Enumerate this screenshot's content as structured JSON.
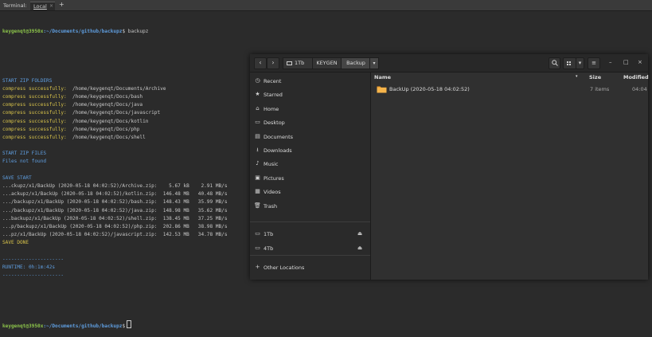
{
  "terminal": {
    "title": "Terminal:",
    "tab_label": "Local",
    "tab_close": "×",
    "add_tab": "+",
    "prompt_user": "keygenqt@3950x",
    "prompt_path": ":~/Documents/github/backupz",
    "prompt_symbol": "$",
    "command": " backupz",
    "lines": [
      {
        "parts": [
          {
            "text": "START ZIP FOLDERS",
            "cls": "c-blue"
          }
        ]
      },
      {
        "parts": [
          {
            "text": "compress successfully:",
            "cls": "c-yellow"
          },
          {
            "text": "  /home/keygenqt/Documents/Archive",
            "cls": "c-white"
          }
        ]
      },
      {
        "parts": [
          {
            "text": "compress successfully:",
            "cls": "c-yellow"
          },
          {
            "text": "  /home/keygenqt/Docs/bash",
            "cls": "c-white"
          }
        ]
      },
      {
        "parts": [
          {
            "text": "compress successfully:",
            "cls": "c-yellow"
          },
          {
            "text": "  /home/keygenqt/Docs/java",
            "cls": "c-white"
          }
        ]
      },
      {
        "parts": [
          {
            "text": "compress successfully:",
            "cls": "c-yellow"
          },
          {
            "text": "  /home/keygenqt/Docs/javascript",
            "cls": "c-white"
          }
        ]
      },
      {
        "parts": [
          {
            "text": "compress successfully:",
            "cls": "c-yellow"
          },
          {
            "text": "  /home/keygenqt/Docs/kotlin",
            "cls": "c-white"
          }
        ]
      },
      {
        "parts": [
          {
            "text": "compress successfully:",
            "cls": "c-yellow"
          },
          {
            "text": "  /home/keygenqt/Docs/php",
            "cls": "c-white"
          }
        ]
      },
      {
        "parts": [
          {
            "text": "compress successfully:",
            "cls": "c-yellow"
          },
          {
            "text": "  /home/keygenqt/Docs/shell",
            "cls": "c-white"
          }
        ]
      },
      {
        "parts": [
          {
            "text": "",
            "cls": "c-white"
          }
        ]
      },
      {
        "parts": [
          {
            "text": "START ZIP FILES",
            "cls": "c-blue"
          }
        ]
      },
      {
        "parts": [
          {
            "text": "Files not found",
            "cls": "c-blue"
          }
        ]
      },
      {
        "parts": [
          {
            "text": "",
            "cls": "c-white"
          }
        ]
      },
      {
        "parts": [
          {
            "text": "SAVE START",
            "cls": "c-blue"
          }
        ]
      },
      {
        "parts": [
          {
            "text": "...ckupz/x1/BackUp (2020-05-18 04:02:52)/Archive.zip:    5.67 kB    2.91 MB/s",
            "cls": "c-white"
          }
        ]
      },
      {
        "parts": [
          {
            "text": "...ackupz/x1/BackUp (2020-05-18 04:02:52)/kotlin.zip:  146.48 MB   40.48 MB/s",
            "cls": "c-white"
          }
        ]
      },
      {
        "parts": [
          {
            "text": ".../backupz/x1/BackUp (2020-05-18 04:02:52)/bash.zip:  148.43 MB   35.99 MB/s",
            "cls": "c-white"
          }
        ]
      },
      {
        "parts": [
          {
            "text": ".../backupz/x1/BackUp (2020-05-18 04:02:52)/java.zip:  148.98 MB   35.62 MB/s",
            "cls": "c-white"
          }
        ]
      },
      {
        "parts": [
          {
            "text": "...backupz/x1/BackUp (2020-05-18 04:02:52)/shell.zip:  138.45 MB   37.25 MB/s",
            "cls": "c-white"
          }
        ]
      },
      {
        "parts": [
          {
            "text": "...p/backupz/x1/BackUp (2020-05-18 04:02:52)/php.zip:  202.86 MB   38.98 MB/s",
            "cls": "c-white"
          }
        ]
      },
      {
        "parts": [
          {
            "text": "...pz/x1/BackUp (2020-05-18 04:02:52)/javascript.zip:  142.53 MB   34.78 MB/s",
            "cls": "c-white"
          }
        ]
      },
      {
        "parts": [
          {
            "text": "SAVE DONE",
            "cls": "c-yellow"
          }
        ]
      },
      {
        "parts": [
          {
            "text": "",
            "cls": "c-white"
          }
        ]
      },
      {
        "parts": [
          {
            "text": "---------------------",
            "cls": "c-blue"
          }
        ]
      },
      {
        "parts": [
          {
            "text": "RUNTIME: 0h:1m:42s",
            "cls": "c-blue"
          }
        ]
      },
      {
        "parts": [
          {
            "text": "---------------------",
            "cls": "c-blue"
          }
        ]
      }
    ]
  },
  "file_manager": {
    "back_icon": "‹",
    "forward_icon": "›",
    "breadcrumb": [
      "1Tb",
      "KEYGEN",
      "Backup"
    ],
    "breadcrumb_dropdown": "▾",
    "search_icon": "search-icon",
    "view_icon": "grid-view-icon",
    "view_dropdown": "▾",
    "menu_icon": "≡",
    "minimize": "–",
    "maximize": "□",
    "close": "×",
    "sidebar": [
      {
        "label": "Recent",
        "icon": "◷"
      },
      {
        "label": "Starred",
        "icon": "★"
      },
      {
        "label": "Home",
        "icon": "⌂"
      },
      {
        "label": "Desktop",
        "icon": "▭"
      },
      {
        "label": "Documents",
        "icon": "▤"
      },
      {
        "label": "Downloads",
        "icon": "⭳"
      },
      {
        "label": "Music",
        "icon": "♪"
      },
      {
        "label": "Pictures",
        "icon": "▣"
      },
      {
        "label": "Videos",
        "icon": "▦"
      },
      {
        "label": "Trash",
        "icon": "🗑"
      }
    ],
    "drives": [
      {
        "label": "1Tb",
        "icon": "▭",
        "eject": "⏏"
      },
      {
        "label": "4Tb",
        "icon": "▭",
        "eject": "⏏"
      }
    ],
    "other_locations": {
      "label": "Other Locations",
      "icon": "+"
    },
    "columns": {
      "name": "Name",
      "size": "Size",
      "modified": "Modified",
      "sort_arrow": "▾"
    },
    "files": [
      {
        "name": "BackUp (2020-05-18 04:02:52)",
        "size": "7 items",
        "modified": "04:04",
        "folder_color": "#f0a030"
      }
    ]
  }
}
